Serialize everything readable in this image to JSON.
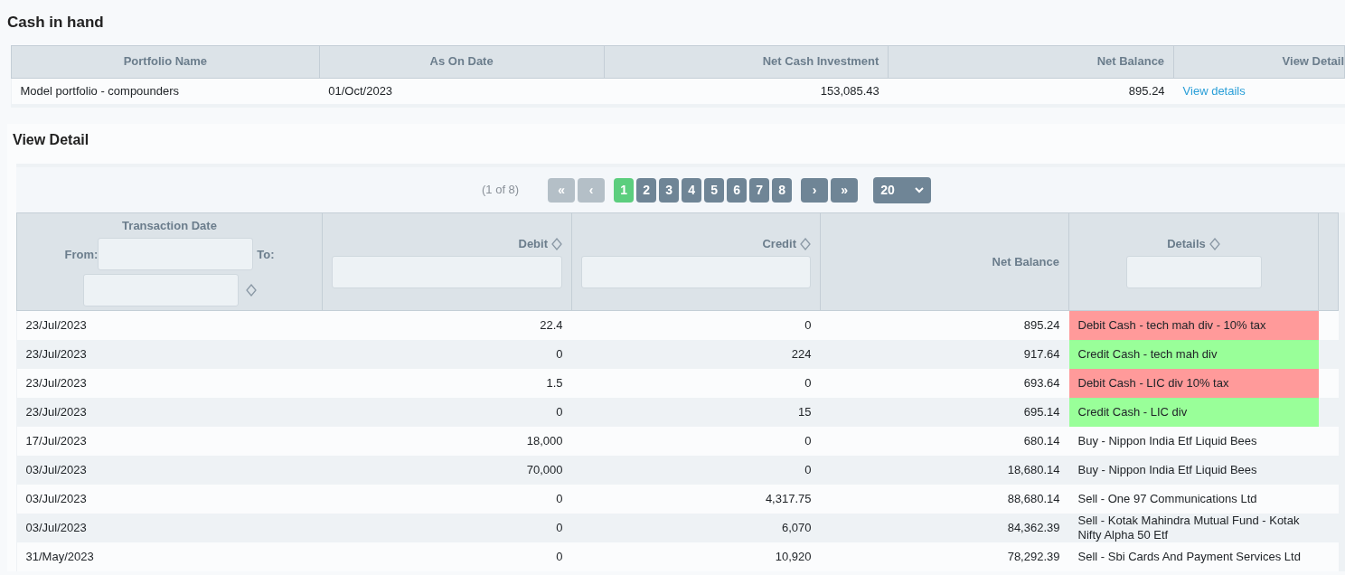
{
  "title": "Cash in hand",
  "summary": {
    "columns": [
      "Portfolio Name",
      "As On Date",
      "Net Cash Investment",
      "Net Balance",
      "View Detail"
    ],
    "rows": [
      {
        "portfolio": "Model portfolio - compounders",
        "date": "01/Oct/2023",
        "investment": "153,085.43",
        "balance": "895.24",
        "link": "View details"
      }
    ]
  },
  "detail": {
    "title": "View Detail",
    "pager": {
      "info": "(1 of 8)",
      "first": {
        "label": "«",
        "disabled": true
      },
      "prev": {
        "label": "‹",
        "disabled": true
      },
      "pages": [
        {
          "label": "1",
          "selected": true
        },
        {
          "label": "2",
          "selected": false
        },
        {
          "label": "3",
          "selected": false
        },
        {
          "label": "4",
          "selected": false
        },
        {
          "label": "5",
          "selected": false
        },
        {
          "label": "6",
          "selected": false
        },
        {
          "label": "7",
          "selected": false
        },
        {
          "label": "8",
          "selected": false
        }
      ],
      "next": {
        "label": "›",
        "disabled": false
      },
      "last": {
        "label": "»",
        "disabled": false
      },
      "page_size": "20"
    },
    "columns": {
      "date": {
        "label": "Transaction Date",
        "from": "From:",
        "to": "To:"
      },
      "debit": "Debit",
      "credit": "Credit",
      "balance": "Net Balance",
      "details": "Details"
    },
    "rows": [
      {
        "date": "23/Jul/2023",
        "debit": "22.4",
        "credit": "0",
        "balance": "895.24",
        "details": "Debit Cash - tech mah div - 10% tax",
        "kind": "debit"
      },
      {
        "date": "23/Jul/2023",
        "debit": "0",
        "credit": "224",
        "balance": "917.64",
        "details": "Credit Cash - tech mah div",
        "kind": "credit"
      },
      {
        "date": "23/Jul/2023",
        "debit": "1.5",
        "credit": "0",
        "balance": "693.64",
        "details": "Debit Cash - LIC div 10% tax",
        "kind": "debit"
      },
      {
        "date": "23/Jul/2023",
        "debit": "0",
        "credit": "15",
        "balance": "695.14",
        "details": "Credit Cash - LIC div",
        "kind": "credit"
      },
      {
        "date": "17/Jul/2023",
        "debit": "18,000",
        "credit": "0",
        "balance": "680.14",
        "details": "Buy - Nippon India Etf Liquid Bees",
        "kind": "trade"
      },
      {
        "date": "03/Jul/2023",
        "debit": "70,000",
        "credit": "0",
        "balance": "18,680.14",
        "details": "Buy - Nippon India Etf Liquid Bees",
        "kind": "trade"
      },
      {
        "date": "03/Jul/2023",
        "debit": "0",
        "credit": "4,317.75",
        "balance": "88,680.14",
        "details": "Sell - One 97 Communications Ltd",
        "kind": "trade"
      },
      {
        "date": "03/Jul/2023",
        "debit": "0",
        "credit": "6,070",
        "balance": "84,362.39",
        "details": "Sell - Kotak Mahindra Mutual Fund - Kotak Nifty Alpha 50 Etf",
        "kind": "trade"
      },
      {
        "date": "31/May/2023",
        "debit": "0",
        "credit": "10,920",
        "balance": "78,292.39",
        "details": "Sell - Sbi Cards And Payment Services Ltd",
        "kind": "trade"
      }
    ]
  }
}
